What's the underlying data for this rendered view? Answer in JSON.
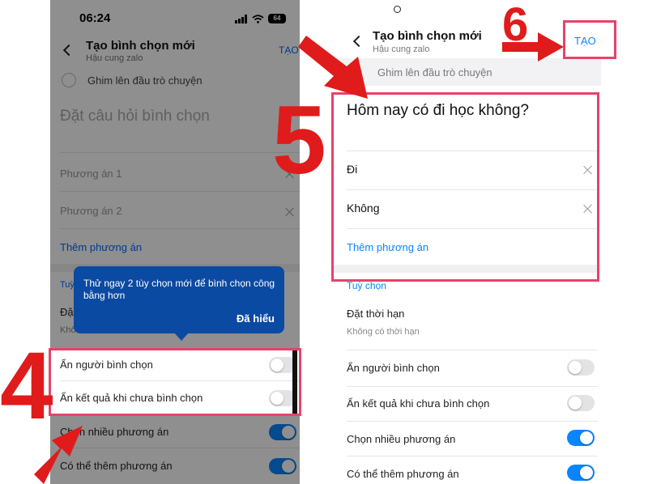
{
  "left_phone": {
    "status": {
      "time": "06:24",
      "battery": "64"
    },
    "header": {
      "title": "Tạo bình chọn mới",
      "subtitle": "Hậu cung zalo",
      "action": "TẠO"
    },
    "pin_label": "Ghim lên đầu trò chuyện",
    "question_placeholder": "Đặt câu hỏi bình chọn",
    "options": [
      "Phương án 1",
      "Phương án 2"
    ],
    "add_option": "Thêm phương án",
    "section_label": "Tuỳ",
    "deadline_partial": "Đặt",
    "deadline_sub_partial": "Khô",
    "tooltip": {
      "text": "Thử ngay 2 tùy chọn mới để bình chọn công bằng hơn",
      "button": "Đã hiểu"
    },
    "settings": [
      {
        "label": "Ẩn người bình chọn",
        "on": false
      },
      {
        "label": "Ẩn kết quả khi chưa bình chọn",
        "on": false
      },
      {
        "label": "Chọn nhiều phương án",
        "on": true
      },
      {
        "label": "Có thể thêm phương án",
        "on": true
      }
    ]
  },
  "right_phone": {
    "header": {
      "title": "Tạo bình chọn mới",
      "subtitle": "Hậu cung zalo",
      "action": "TẠO"
    },
    "pin_label": "Ghim lên đầu trò chuyện",
    "question": "Hôm nay có đi học không?",
    "options": [
      "Đi",
      "Không"
    ],
    "add_option": "Thêm phương án",
    "section_label": "Tuỳ chọn",
    "deadline": {
      "label": "Đặt thời hạn",
      "value": "Không có thời hạn"
    },
    "settings": [
      {
        "label": "Ẩn người bình chọn",
        "on": false
      },
      {
        "label": "Ẩn kết quả khi chưa bình chọn",
        "on": false
      },
      {
        "label": "Chọn nhiều phương án",
        "on": true
      },
      {
        "label": "Có thể thêm phương án",
        "on": true
      }
    ]
  },
  "annotations": {
    "step_4": "4",
    "step_5": "5",
    "step_6": "6"
  },
  "colors": {
    "accent_blue": "#0a84ff",
    "annotation_red": "#e01b1b",
    "highlight_pink": "#e6436a",
    "tooltip_blue": "#0b4aa2"
  }
}
